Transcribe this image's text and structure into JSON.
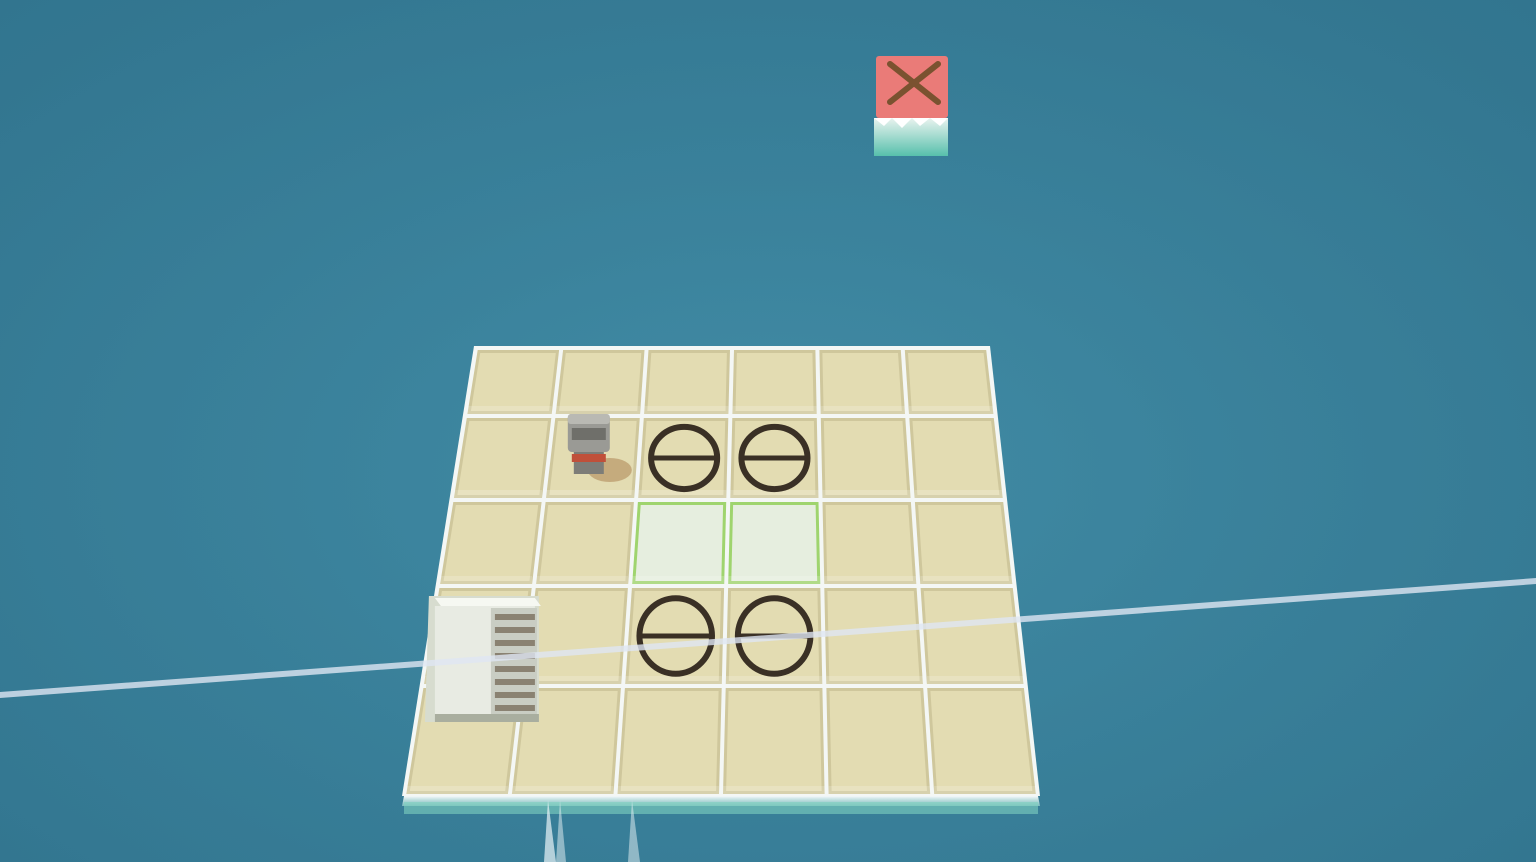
{
  "scene": {
    "background_color": "#3a829c",
    "board": {
      "rows": 5,
      "cols": 6,
      "tile_color": "#e3dcb2",
      "tile_edge_color": "#cfc79c",
      "gap_color": "#f4f7f5"
    },
    "special_tiles": [
      {
        "row": 1,
        "col": 2,
        "kind": "circle-target"
      },
      {
        "row": 1,
        "col": 3,
        "kind": "circle-target"
      },
      {
        "row": 2,
        "col": 2,
        "kind": "pale-mossy"
      },
      {
        "row": 2,
        "col": 3,
        "kind": "pale-mossy"
      },
      {
        "row": 3,
        "col": 2,
        "kind": "circle-target"
      },
      {
        "row": 3,
        "col": 3,
        "kind": "circle-target"
      }
    ],
    "robot": {
      "row": 1,
      "col": 1,
      "icon": "robot-character-icon"
    },
    "crate": {
      "row": 3,
      "col": 0,
      "icon": "vented-crate-icon"
    },
    "close_button": {
      "icon": "close-x-icon",
      "color": "#ea7b78"
    },
    "colors": {
      "target_ring": "#3a3025",
      "moss": "#9fd46e",
      "pale_tile": "#e6eedf",
      "robot_body": "#9a9a95",
      "crate_body": "#e8ebe3"
    }
  }
}
